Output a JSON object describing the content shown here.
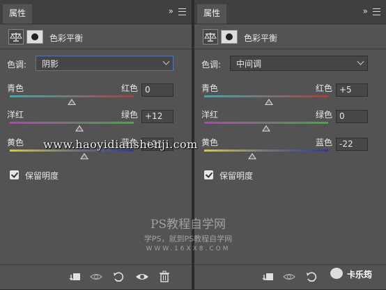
{
  "left_panel": {
    "tab": "属性",
    "title": "色彩平衡",
    "tone_label": "色调:",
    "tone_value": "阴影",
    "sliders": [
      {
        "left": "青色",
        "right": "红色",
        "value": "0",
        "level": 0.5
      },
      {
        "left": "洋红",
        "right": "绿色",
        "value": "+12",
        "level": 0.56
      },
      {
        "left": "黄色",
        "right": "蓝色",
        "value": "+21",
        "level": 0.6
      }
    ],
    "preserve_label": "保留明度"
  },
  "right_panel": {
    "tab": "属性",
    "title": "色彩平衡",
    "tone_label": "色调:",
    "tone_value": "中间调",
    "sliders": [
      {
        "left": "青色",
        "right": "红色",
        "value": "+5",
        "level": 0.52
      },
      {
        "left": "洋红",
        "right": "绿色",
        "value": "0",
        "level": 0.5
      },
      {
        "left": "黄色",
        "right": "蓝色",
        "value": "-22",
        "level": 0.39
      }
    ],
    "preserve_label": "保留明度"
  },
  "watermark": {
    "url": "www.haoyidianshenji.com",
    "brand": "PS教程自学网",
    "brand_sub": "学PS，就到PS教程自学网",
    "brand_url": "WWW.16XX8.COM",
    "wechat": "卡乐筠"
  },
  "icons": {
    "balance": "balance-icon",
    "mask": "mask-icon",
    "clip": "clip-to-layer-icon",
    "view_previous": "view-previous-icon",
    "reset": "reset-icon",
    "visibility": "visibility-icon",
    "delete": "trash-icon"
  },
  "colors": {
    "panel_bg": "#535353",
    "tab_bg": "#404040",
    "select_focus": "#4a76b8"
  }
}
